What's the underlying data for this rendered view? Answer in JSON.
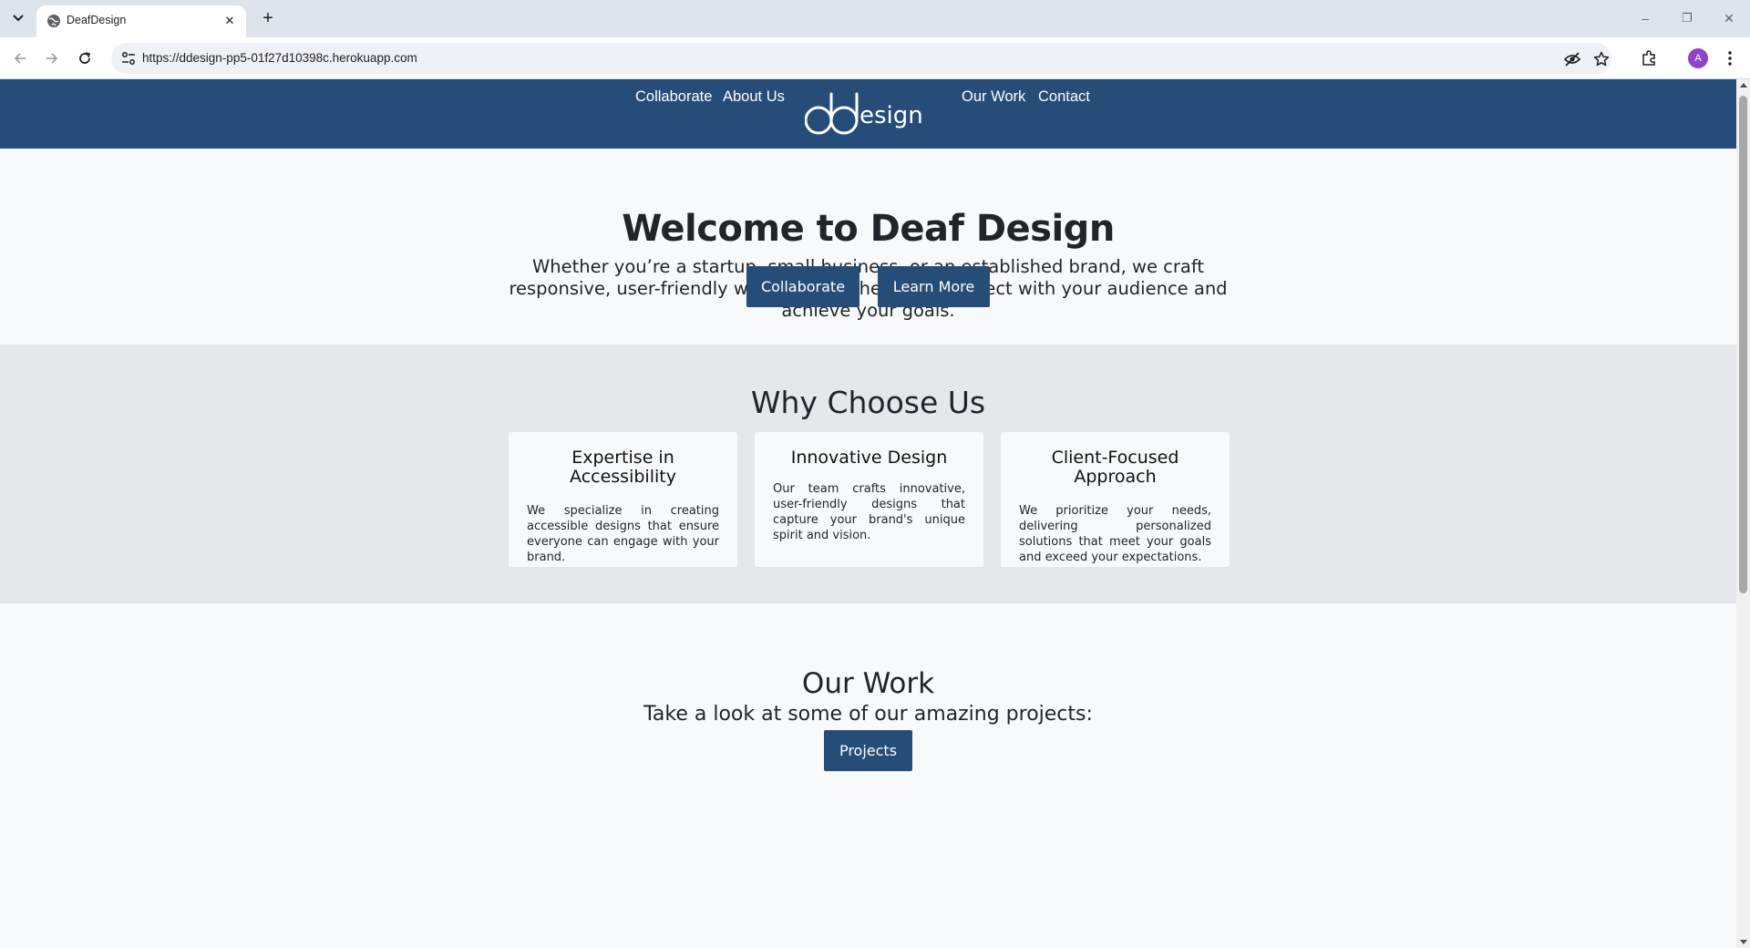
{
  "browser": {
    "tab_title": "DeafDesign",
    "url": "https://ddesign-pp5-01f27d10398c.herokuapp.com",
    "profile_initial": "A",
    "icons": [
      "tab-list-icon",
      "globe-icon",
      "close-icon",
      "new-tab-icon",
      "minimize-icon",
      "restore-icon",
      "window-close-icon",
      "back-icon",
      "forward-icon",
      "reload-icon",
      "site-settings-icon",
      "eye-off-icon",
      "star-icon",
      "extensions-icon",
      "avatar",
      "kebab-menu-icon"
    ],
    "window": {
      "minimize": "–",
      "restore": "❐",
      "close": "✕"
    }
  },
  "nav": {
    "links_left": [
      "Collaborate",
      "About Us"
    ],
    "links_right": [
      "Our Work",
      "Contact"
    ],
    "logo": {
      "mark": "dd",
      "text": "esign"
    },
    "bg_color": "#264d78"
  },
  "hero": {
    "title": "Welcome to Deaf Design",
    "subtitle": "Whether you’re a startup, small business, or an established brand, we craft responsive, user-friendly websites that help you connect with your audience and achieve your goals.",
    "buttons": [
      "Collaborate",
      "Learn More"
    ]
  },
  "why": {
    "title": "Why Choose Us",
    "cards": [
      {
        "title": "Expertise in Accessibility",
        "text": "We specialize in creating accessible designs that ensure everyone can engage with your brand."
      },
      {
        "title": "Innovative Design",
        "text": "Our team crafts innovative, user-friendly designs that capture your brand's unique spirit and vision."
      },
      {
        "title": "Client-Focused Approach",
        "text": "We prioritize your needs, delivering personalized solutions that meet your goals and exceed your expectations."
      }
    ]
  },
  "work": {
    "title": "Our Work",
    "subtitle": "Take a look at some of our amazing projects:",
    "button": "Projects"
  }
}
